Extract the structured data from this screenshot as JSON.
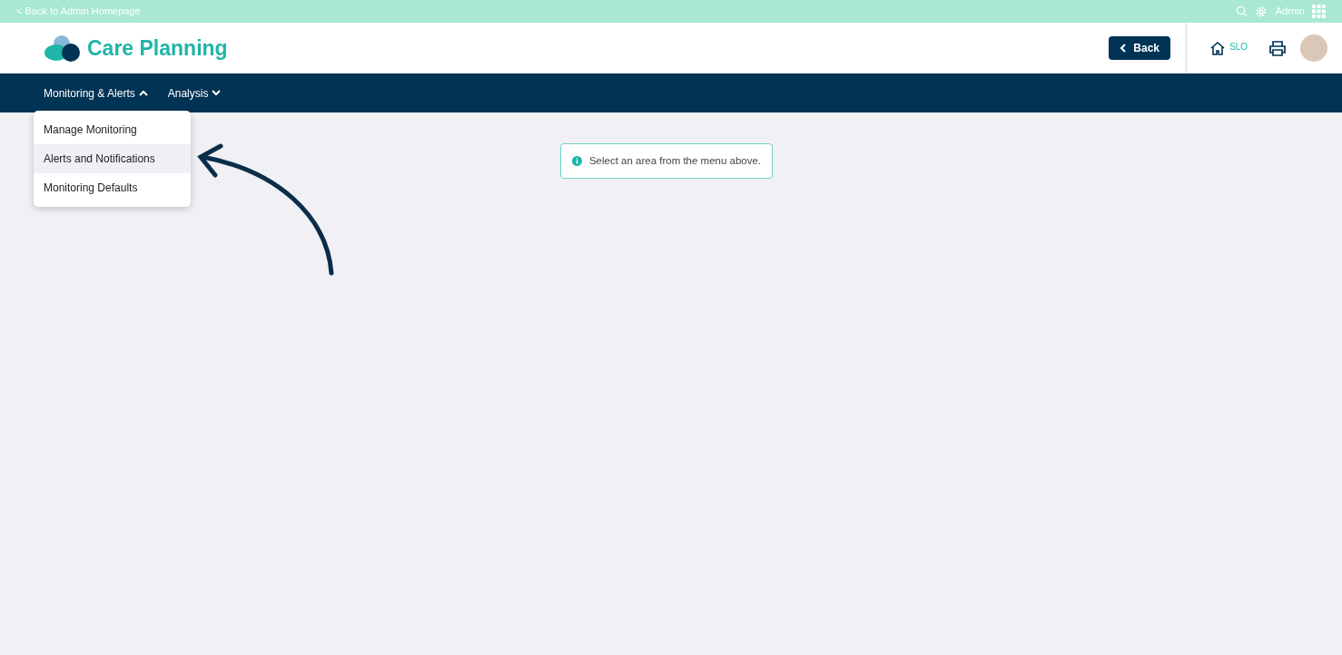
{
  "top_bar": {
    "back_link": "< Back to Admin Homepage",
    "user": "Admin"
  },
  "header": {
    "app_title": "Care Planning",
    "back_button": "Back",
    "home_label": "SLO"
  },
  "nav": [
    {
      "label": "Monitoring & Alerts",
      "expanded": true,
      "items": [
        {
          "label": "Manage Monitoring",
          "selected": false
        },
        {
          "label": "Alerts and Notifications",
          "selected": true
        },
        {
          "label": "Monitoring Defaults",
          "selected": false
        }
      ]
    },
    {
      "label": "Analysis",
      "expanded": false
    }
  ],
  "info_message": "Select an area from the menu above."
}
